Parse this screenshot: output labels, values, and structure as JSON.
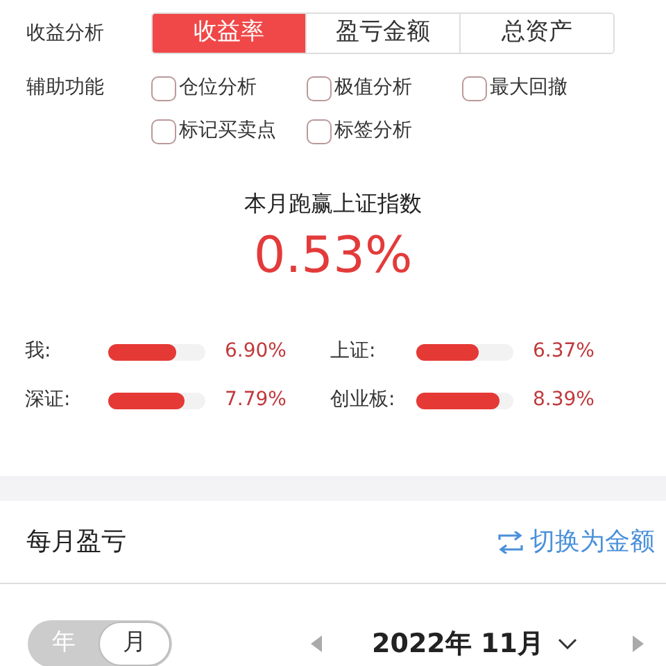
{
  "analysis": {
    "label": "收益分析",
    "tabs": [
      {
        "label": "收益率",
        "selected": true
      },
      {
        "label": "盈亏金额",
        "selected": false
      },
      {
        "label": "总资产",
        "selected": false
      }
    ]
  },
  "aux": {
    "label": "辅助功能",
    "options": [
      {
        "label": "仓位分析",
        "checked": false
      },
      {
        "label": "极值分析",
        "checked": false
      },
      {
        "label": "最大回撤",
        "checked": false
      },
      {
        "label": "标记买卖点",
        "checked": false
      },
      {
        "label": "标签分析",
        "checked": false
      }
    ]
  },
  "summary": {
    "title": "本月跑赢上证指数",
    "value": "0.53%"
  },
  "compare": [
    {
      "label": "我:",
      "level": 0.7,
      "reading": "6.90%"
    },
    {
      "label": "上证:",
      "level": 0.64,
      "reading": "6.37%"
    },
    {
      "label": "深证:",
      "level": 0.79,
      "reading": "7.79%"
    },
    {
      "label": "创业板:",
      "level": 0.85,
      "reading": "8.39%"
    }
  ],
  "monthly": {
    "title": "每月盈亏",
    "switch_label": "切换为金额",
    "toggle": [
      {
        "label": "年",
        "selected": false
      },
      {
        "label": "月",
        "selected": true
      }
    ],
    "period": "2022年 11月"
  }
}
